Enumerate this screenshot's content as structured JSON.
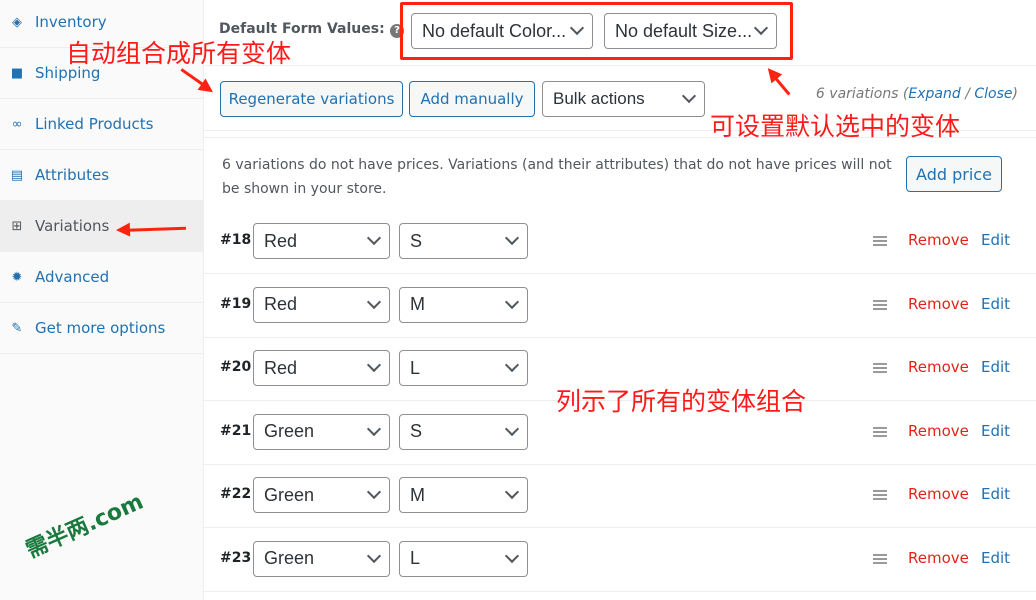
{
  "sidebar": {
    "items": [
      {
        "label": "Inventory",
        "icon": "tag-icon"
      },
      {
        "label": "Shipping",
        "icon": "truck-icon"
      },
      {
        "label": "Linked Products",
        "icon": "link-icon"
      },
      {
        "label": "Attributes",
        "icon": "list-icon"
      },
      {
        "label": "Variations",
        "icon": "grid-icon",
        "active": true
      },
      {
        "label": "Advanced",
        "icon": "gear-icon"
      },
      {
        "label": "Get more options",
        "icon": "plugin-icon"
      }
    ]
  },
  "defaults": {
    "label": "Default Form Values:",
    "help": "?",
    "color": "No default Color...",
    "size": "No default Size..."
  },
  "toolbar": {
    "regenerate": "Regenerate variations",
    "add_manually": "Add manually",
    "bulk": "Bulk actions",
    "count": "6 variations",
    "expand": "Expand",
    "close": "Close"
  },
  "notice": {
    "text": "6 variations do not have prices. Variations (and their attributes) that do not have prices will not be shown in your store.",
    "button": "Add price"
  },
  "variations": [
    {
      "id": "#18",
      "color": "Red",
      "size": "S"
    },
    {
      "id": "#19",
      "color": "Red",
      "size": "M"
    },
    {
      "id": "#20",
      "color": "Red",
      "size": "L"
    },
    {
      "id": "#21",
      "color": "Green",
      "size": "S"
    },
    {
      "id": "#22",
      "color": "Green",
      "size": "M"
    },
    {
      "id": "#23",
      "color": "Green",
      "size": "L"
    }
  ],
  "row_actions": {
    "remove": "Remove",
    "edit": "Edit"
  },
  "annotations": {
    "a1": "自动组合成所有变体",
    "a2": "可设置默认选中的变体",
    "a3": "列示了所有的变体组合"
  },
  "watermark": "需半两.com",
  "colors": {
    "link": "#2271b1",
    "remove": "#e2231a",
    "annotation": "#ff1a1a"
  }
}
